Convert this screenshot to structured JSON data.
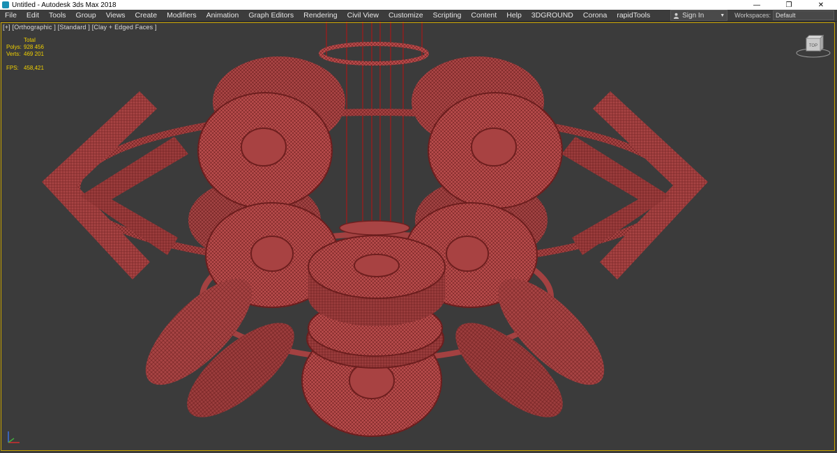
{
  "window": {
    "title": "Untitled - Autodesk 3ds Max 2018"
  },
  "menu": {
    "items": [
      "File",
      "Edit",
      "Tools",
      "Group",
      "Views",
      "Create",
      "Modifiers",
      "Animation",
      "Graph Editors",
      "Rendering",
      "Civil View",
      "Customize",
      "Scripting",
      "Content",
      "Help",
      "3DGROUND",
      "Corona",
      "rapidTools"
    ],
    "signin": "Sign In",
    "workspaces_label": "Workspaces:",
    "workspace_value": "Default"
  },
  "viewport": {
    "label": "[+] [Orthographic ] [Standard ] [Clay + Edged Faces ]",
    "stats": {
      "total_label": "Total",
      "polys_label": "Polys:",
      "polys_value": "928 456",
      "verts_label": "Verts:",
      "verts_value": "469 201",
      "fps_label": "FPS:",
      "fps_value": "458,421"
    },
    "viewcube_label": "TOP"
  },
  "colors": {
    "mesh": "#b54a4a",
    "mesh_dark": "#6e1f1f",
    "wire": "#5a1414",
    "viewport_bg": "#3b3b3b",
    "stats": "#f0d000",
    "active_border": "#c9a400"
  }
}
